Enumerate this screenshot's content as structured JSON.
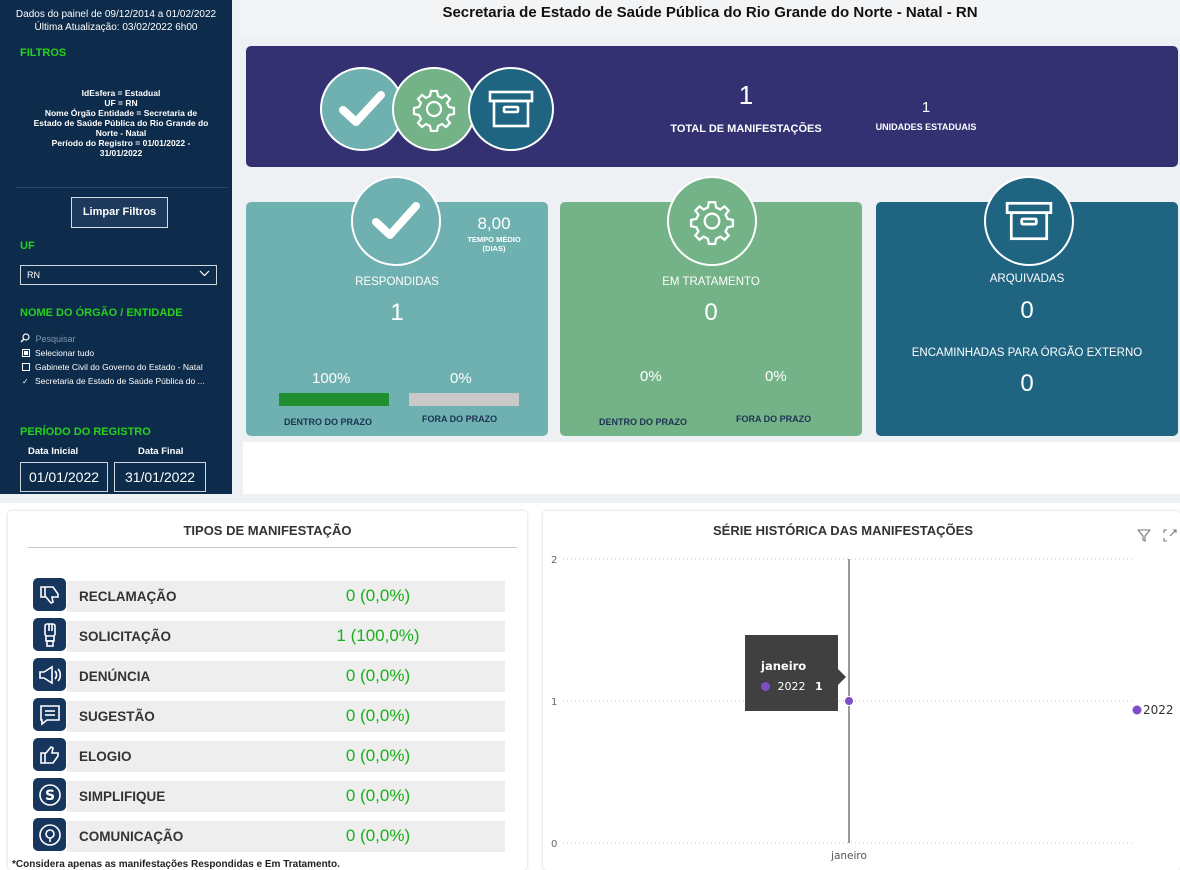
{
  "sidebar": {
    "data_range": "Dados do painel de 09/12/2014 a 01/02/2022",
    "last_update": "Última Atualização: 03/02/2022 6h00",
    "filters_heading": "FILTROS",
    "filter_lines": [
      "IdEsfera = Estadual",
      "UF = RN",
      "Nome Órgão Entidade = Secretaria de",
      "Estado de Saúde Pública do Rio Grande do",
      "Norte - Natal",
      "Período do Registro = 01/01/2022 -",
      "31/01/2022"
    ],
    "clear_button": "Limpar Filtros",
    "uf_heading": "UF",
    "uf_value": "RN",
    "org_heading": "NOME DO ÓRGÃO / ENTIDADE",
    "search_placeholder": "Pesquisar",
    "org_options": [
      {
        "label": "Selecionar tudo",
        "state": "partial"
      },
      {
        "label": "Gabinete Civil do Governo do Estado - Natal",
        "state": "unchecked"
      },
      {
        "label": "Secretaria de Estado de Saúde Pública do ...",
        "state": "checked"
      }
    ],
    "period_heading": "PERÍODO DO REGISTRO",
    "start_label": "Data Inicial",
    "end_label": "Data Final",
    "start_date": "01/01/2022",
    "end_date": "31/01/2022"
  },
  "header": {
    "title": "Secretaria de Estado de Saúde Pública do Rio Grande do Norte - Natal - RN"
  },
  "banner": {
    "total_value": "1",
    "total_label": "TOTAL DE MANIFESTAÇÕES",
    "units_value": "1",
    "units_label": "UNIDADES ESTADUAIS"
  },
  "cards": {
    "respondidas": {
      "label": "RESPONDIDAS",
      "value": "1",
      "avg_time": "8,00",
      "avg_label_1": "TEMPO MÉDIO",
      "avg_label_2": "(DIAS)",
      "in_pct": "100%",
      "out_pct": "0%",
      "in_fraction": 1.0,
      "out_fraction": 0.0,
      "in_label": "DENTRO DO PRAZO",
      "out_label": "FORA DO PRAZO",
      "color": "#6fb1b0"
    },
    "tratamento": {
      "label": "EM TRATAMENTO",
      "value": "0",
      "in_pct": "0%",
      "out_pct": "0%",
      "in_label": "DENTRO DO PRAZO",
      "out_label": "FORA DO PRAZO",
      "color": "#73b387"
    },
    "arquivadas": {
      "label": "ARQUIVADAS",
      "value": "0",
      "ext_label": "ENCAMINHADAS PARA ÓRGÃO EXTERNO",
      "ext_value": "0",
      "color": "#1f6582"
    }
  },
  "types": {
    "title": "TIPOS DE MANIFESTAÇÃO",
    "rows": [
      {
        "name": "RECLAMAÇÃO",
        "value": "0 (0,0%)",
        "icon": "thumbs-down-icon"
      },
      {
        "name": "SOLICITAÇÃO",
        "value": "1 (100,0%)",
        "icon": "hand-raised-icon"
      },
      {
        "name": "DENÚNCIA",
        "value": "0 (0,0%)",
        "icon": "megaphone-icon"
      },
      {
        "name": "SUGESTÃO",
        "value": "0 (0,0%)",
        "icon": "message-icon"
      },
      {
        "name": "ELOGIO",
        "value": "0 (0,0%)",
        "icon": "thumbs-up-icon"
      },
      {
        "name": "SIMPLIFIQUE",
        "value": "0 (0,0%)",
        "icon": "simplifique-s-icon"
      },
      {
        "name": "COMUNICAÇÃO",
        "value": "0 (0,0%)",
        "icon": "communication-icon"
      }
    ],
    "footnote": "*Considera apenas as manifestações Respondidas e Em Tratamento."
  },
  "series_panel": {
    "title": "SÉRIE HISTÓRICA DAS MANIFESTAÇÕES",
    "tooltip_title": "janeiro",
    "tooltip_series": "2022",
    "tooltip_value": "1"
  },
  "colors": {
    "sidebar_bg": "#0d2b4a",
    "accent_green": "#26d21c",
    "banner": "#343173",
    "series_point": "#7b4fc7"
  },
  "chart_data": {
    "type": "line",
    "title": "SÉRIE HISTÓRICA DAS MANIFESTAÇÕES",
    "categories": [
      "janeiro"
    ],
    "series": [
      {
        "name": "2022",
        "values": [
          1
        ]
      }
    ],
    "yticks": [
      0,
      1,
      2
    ],
    "ylim": [
      0,
      2
    ],
    "grid": true,
    "legend": "right"
  }
}
